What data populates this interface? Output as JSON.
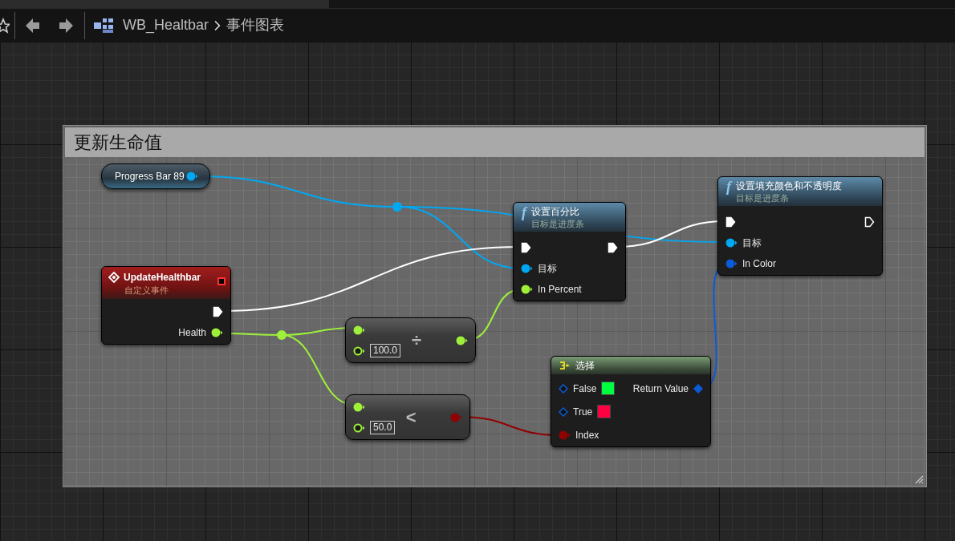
{
  "toolbar": {
    "breadcrumb": [
      {
        "label": "WB_Healtbar"
      },
      {
        "label": "事件图表"
      }
    ]
  },
  "comment": {
    "title": "更新生命值"
  },
  "nodes": [
    {
      "kind": "variable",
      "title": "Progress Bar 89",
      "outputs": [
        {
          "kind": "object",
          "connected": true
        }
      ]
    },
    {
      "kind": "event",
      "title": "UpdateHealthbar",
      "subtitle": "自定义事件",
      "delegate": true,
      "outputs": [
        {
          "kind": "exec",
          "connected": true
        },
        {
          "kind": "float",
          "label": "Health",
          "connected": true
        }
      ]
    },
    {
      "kind": "function",
      "icon": "f",
      "title": "设置百分比",
      "subtitle": "目标是进度条",
      "inputs": [
        {
          "kind": "exec",
          "connected": true
        },
        {
          "kind": "object",
          "label": "目标",
          "connected": true
        },
        {
          "kind": "float",
          "label": "In Percent",
          "connected": true
        }
      ],
      "outputs": [
        {
          "kind": "exec",
          "connected": true
        }
      ]
    },
    {
      "kind": "function",
      "icon": "f",
      "title": "设置填充颜色和不透明度",
      "subtitle": "目标是进度条",
      "inputs": [
        {
          "kind": "exec",
          "connected": true
        },
        {
          "kind": "object",
          "label": "目标",
          "connected": true
        },
        {
          "kind": "color",
          "label": "In Color",
          "connected": true
        }
      ],
      "outputs": [
        {
          "kind": "exec",
          "connected": false
        }
      ]
    },
    {
      "kind": "operator",
      "symbol": "÷",
      "inputs": [
        {
          "kind": "float",
          "connected": true
        },
        {
          "kind": "float",
          "connected": false,
          "default": "100.0"
        }
      ],
      "outputs": [
        {
          "kind": "float",
          "connected": true
        }
      ]
    },
    {
      "kind": "operator",
      "symbol": "<",
      "inputs": [
        {
          "kind": "float",
          "connected": true
        },
        {
          "kind": "float",
          "connected": false,
          "default": "50.0"
        }
      ],
      "outputs": [
        {
          "kind": "bool",
          "connected": true
        }
      ]
    },
    {
      "kind": "select",
      "title": "选择",
      "inputs": [
        {
          "kind": "wildcard",
          "label": "False",
          "connected": false,
          "color": "#00ff40"
        },
        {
          "kind": "wildcard",
          "label": "True",
          "connected": false,
          "color": "#ff0040"
        },
        {
          "kind": "bool",
          "label": "Index",
          "connected": true
        }
      ],
      "outputs": [
        {
          "kind": "wildcard",
          "label": "Return Value",
          "connected": true
        }
      ]
    }
  ]
}
